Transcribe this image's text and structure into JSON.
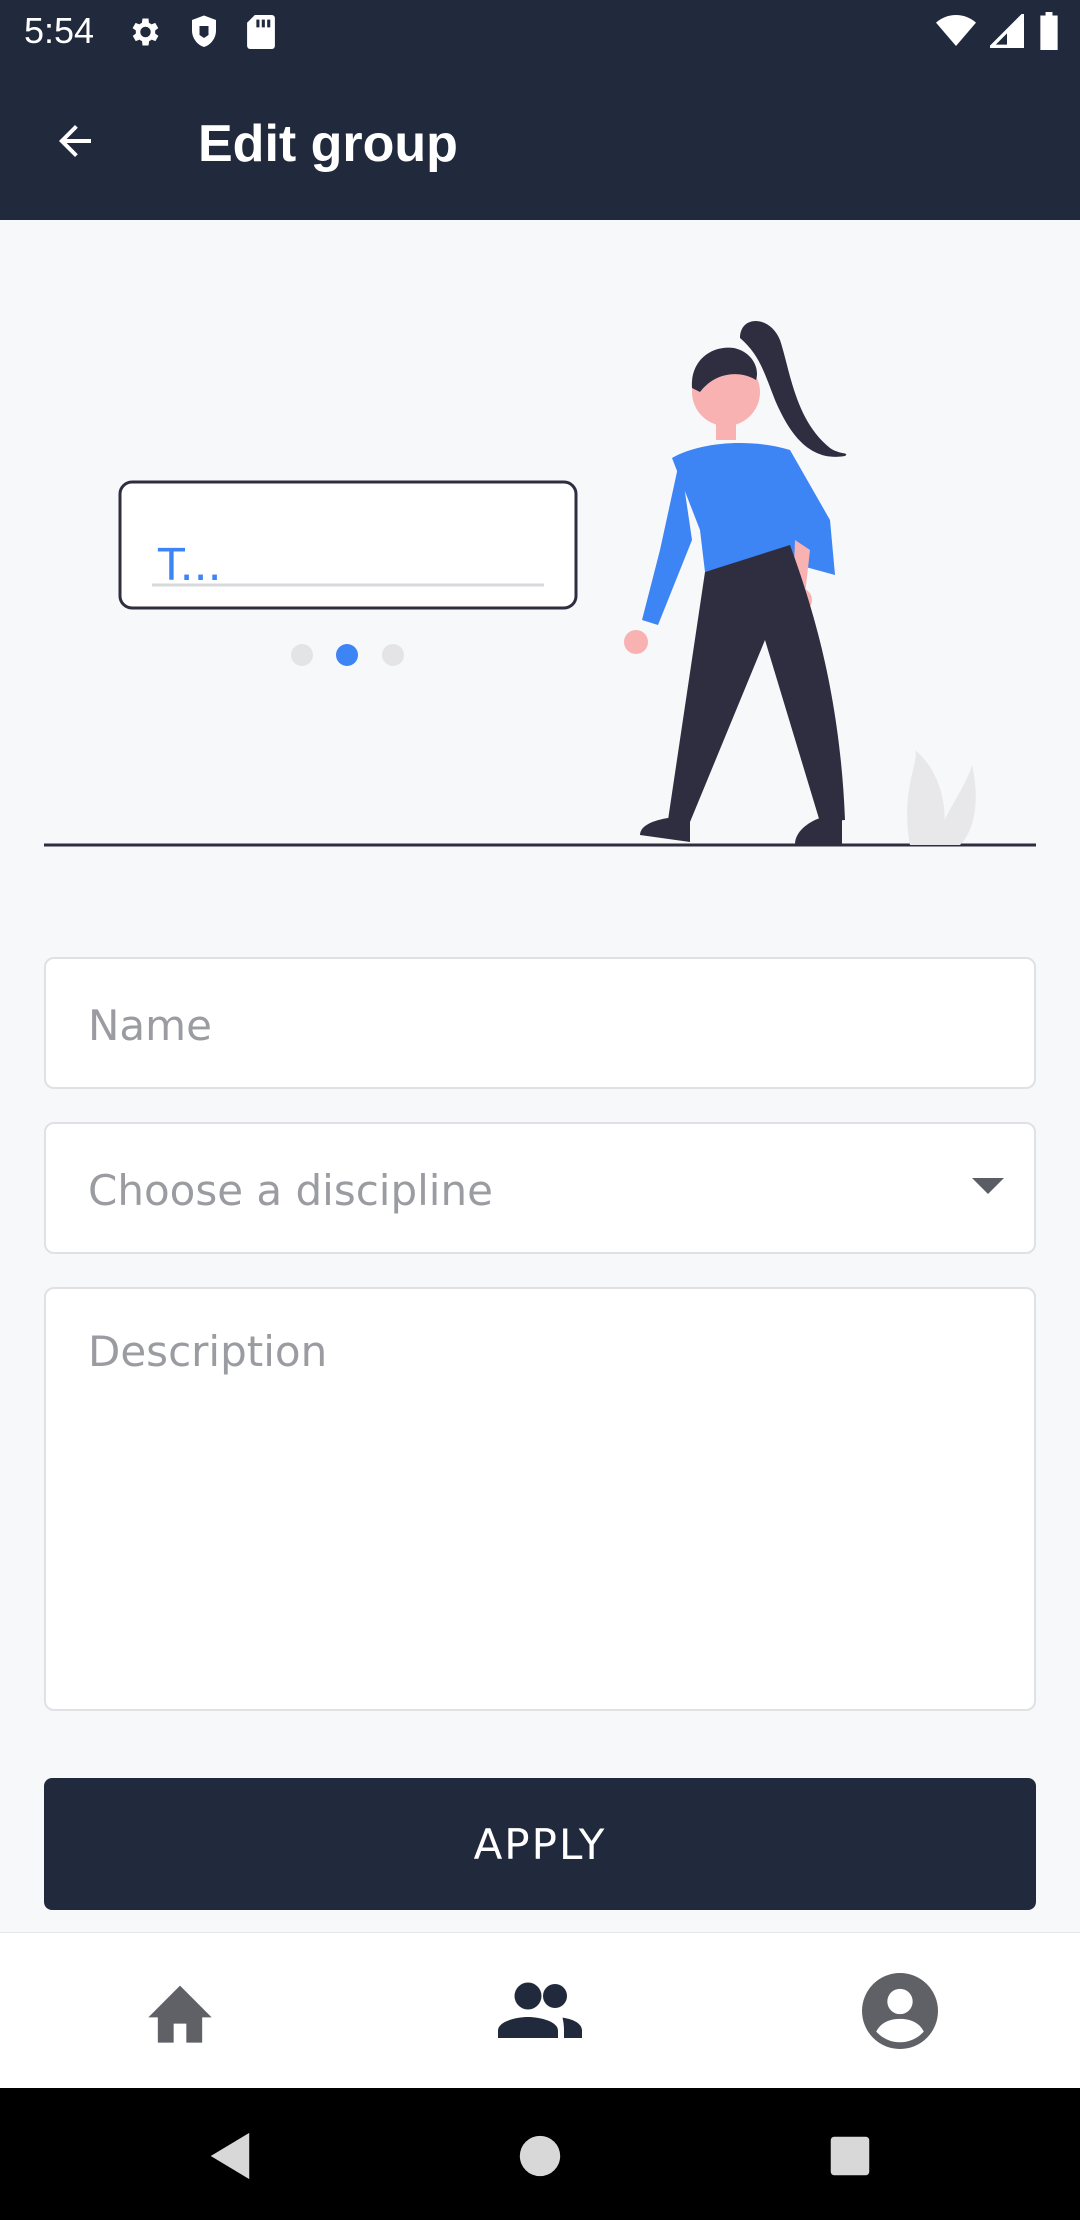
{
  "status_bar": {
    "time": "5:54",
    "left_icons": [
      "gear-icon",
      "shield-icon",
      "sd-card-icon"
    ],
    "right_icons": [
      "wifi-icon",
      "signal-icon",
      "battery-icon"
    ]
  },
  "app_bar": {
    "title": "Edit group",
    "back_icon": "arrow-left-icon"
  },
  "illustration": {
    "input_text": "T...",
    "carousel_dots": 3,
    "active_dot": 1
  },
  "form": {
    "name_placeholder": "Name",
    "discipline_placeholder": "Choose a discipline",
    "description_placeholder": "Description",
    "apply_label": "APPLY"
  },
  "bottom_nav": {
    "items": [
      {
        "icon": "home-icon"
      },
      {
        "icon": "groups-icon"
      },
      {
        "icon": "profile-icon"
      }
    ]
  },
  "colors": {
    "primary": "#212a3d",
    "accent": "#3d84f5",
    "background": "#f7f8fa"
  }
}
